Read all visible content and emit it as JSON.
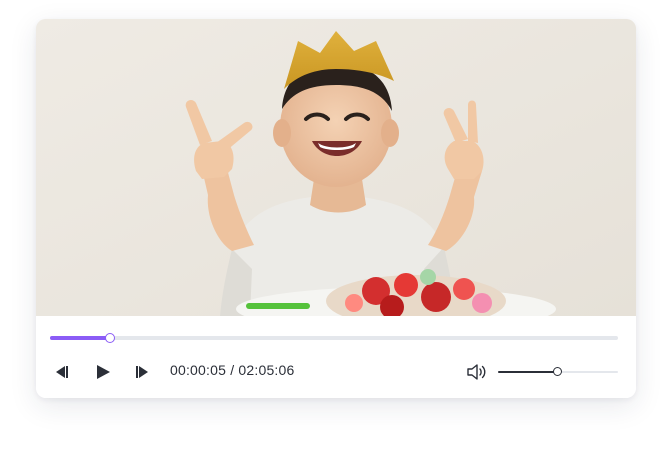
{
  "video": {
    "description_icon": "video-frame",
    "accent_color": "#8b5cf6"
  },
  "playback": {
    "current_time": "00:00:05",
    "separator": "/",
    "duration": "02:05:06",
    "progress_fraction": 0.105
  },
  "volume": {
    "level_fraction": 0.5
  },
  "icons": {
    "previous": "skip-back-icon",
    "play": "play-icon",
    "next": "skip-forward-icon",
    "volume": "speaker-icon"
  }
}
